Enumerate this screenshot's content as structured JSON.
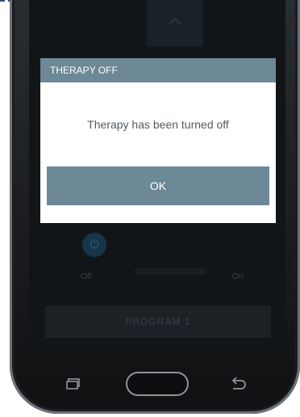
{
  "dialog": {
    "title": "THERAPY OFF",
    "message": "Therapy has been turned off",
    "ok_label": "OK"
  },
  "background": {
    "toggle_off_label": "Off",
    "toggle_on_label": "On",
    "program_button_label": "PROGRAM 1",
    "toggle_icon": "power-icon"
  },
  "navbar": {
    "recents_icon": "recents-icon",
    "home_icon": "home-button",
    "back_icon": "back-icon"
  },
  "colors": {
    "dialog_accent": "#6d8896",
    "screen_background": "#121518"
  }
}
